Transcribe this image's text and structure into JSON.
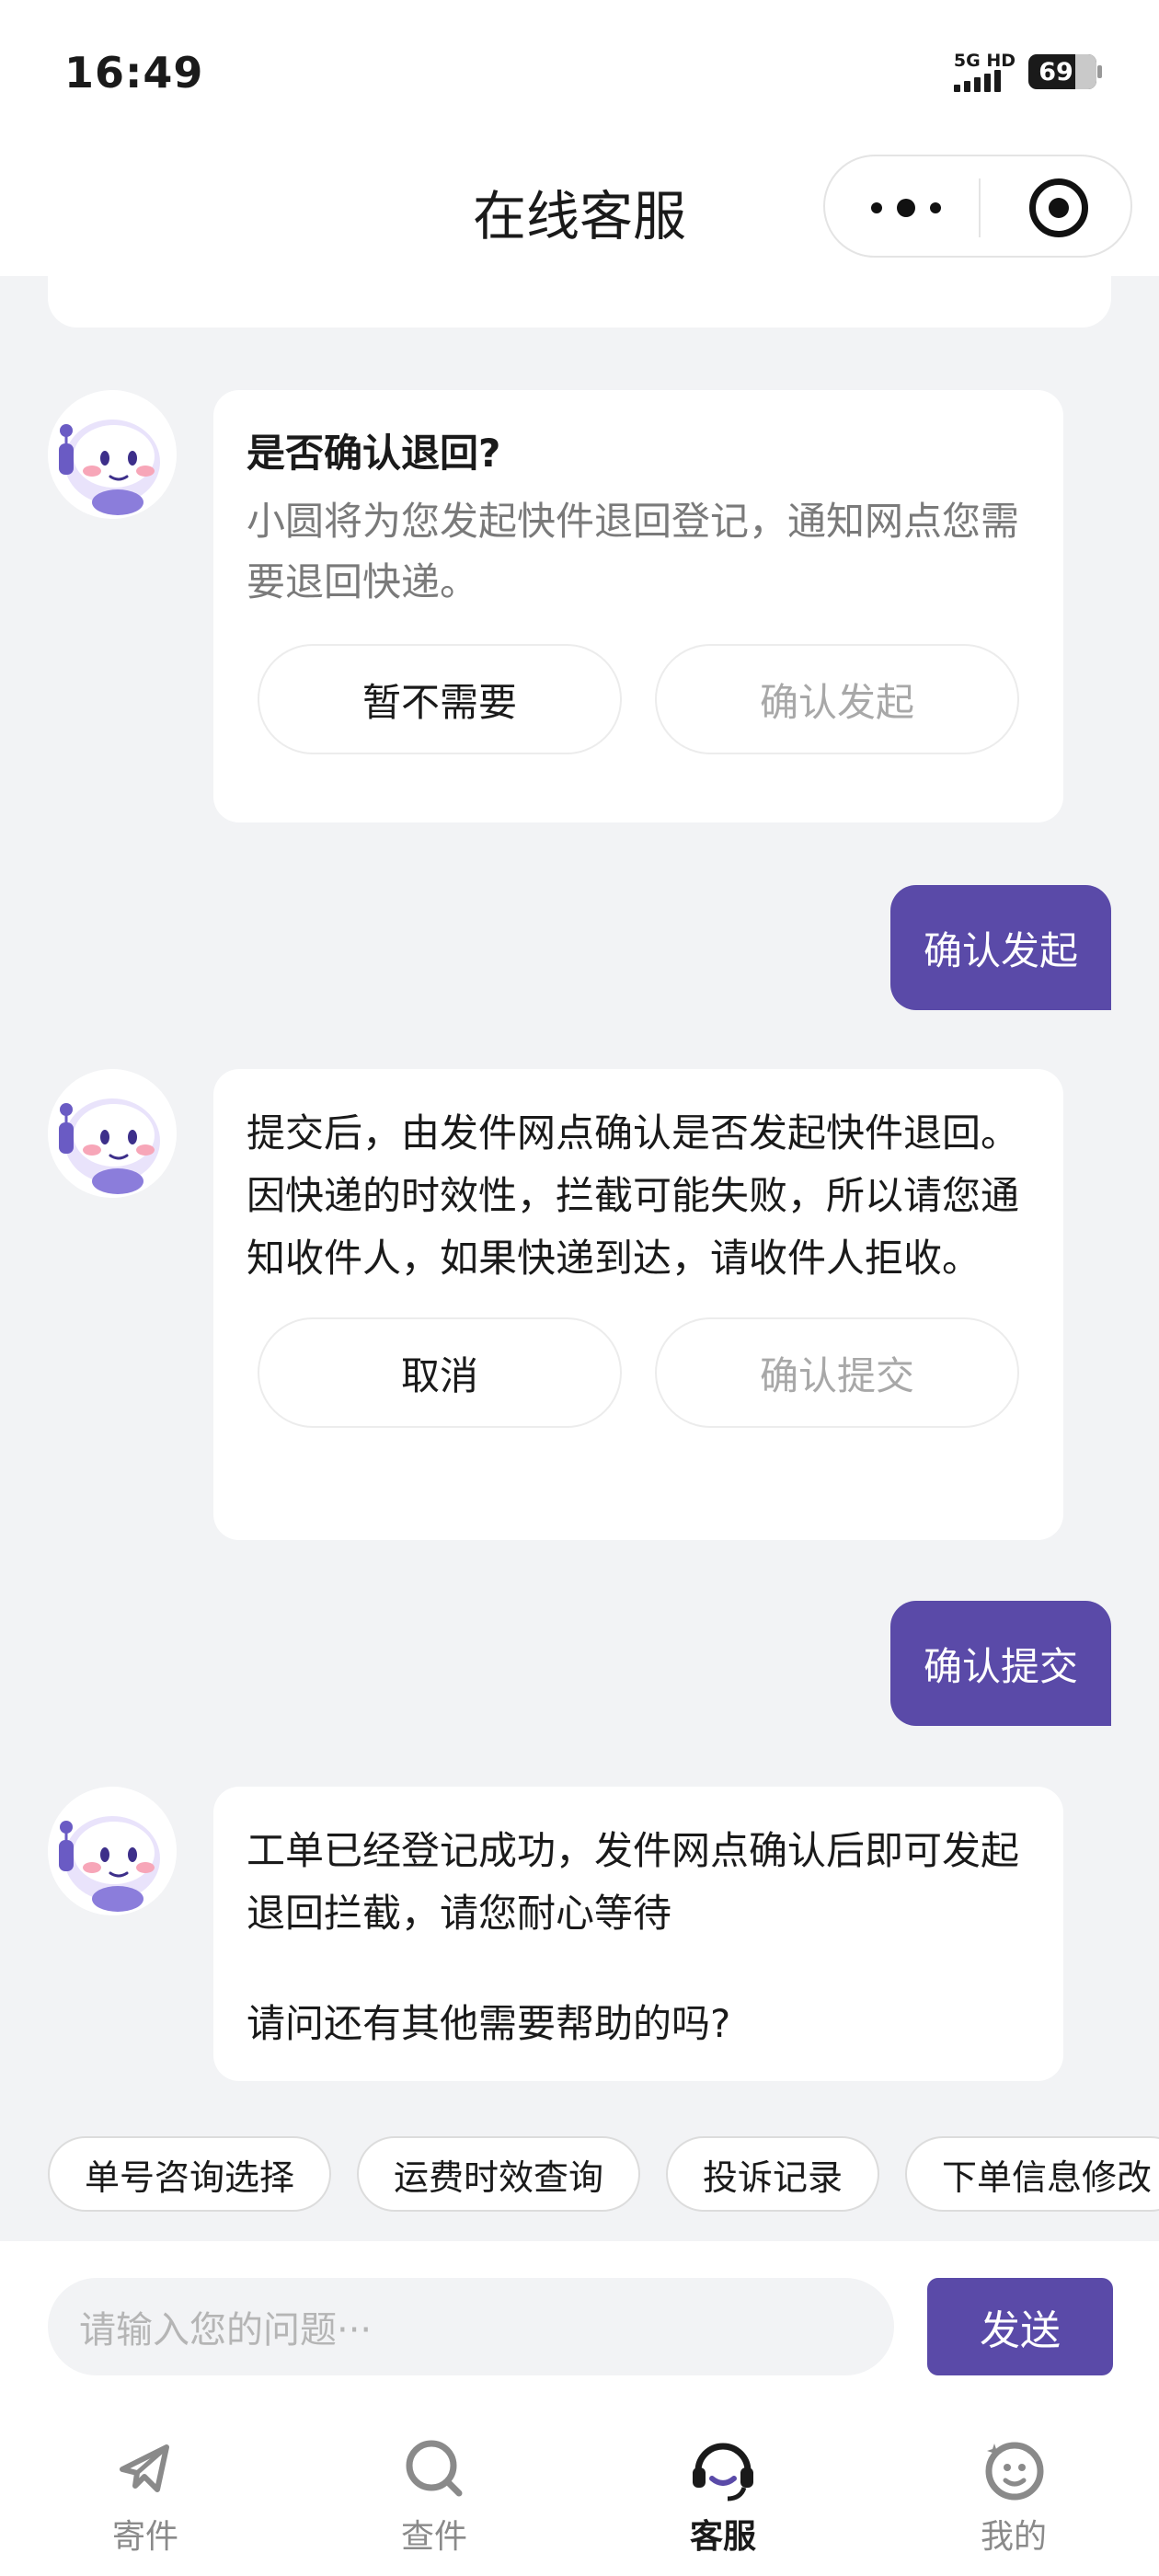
{
  "status_bar": {
    "time": "16:49",
    "network": "5G HD",
    "battery": "69"
  },
  "header": {
    "title": "在线客服"
  },
  "messages": [
    {
      "from": "bot",
      "title": "是否确认退回?",
      "text": "小圆将为您发起快件退回登记，通知网点您需要退回快递。",
      "buttons": [
        "暂不需要",
        "确认发起"
      ]
    },
    {
      "from": "user",
      "text": "确认发起"
    },
    {
      "from": "bot",
      "text": "提交后，由发件网点确认是否发起快件退回。因快递的时效性，拦截可能失败，所以请您通知收件人，如果快递到达，请收件人拒收。",
      "buttons": [
        "取消",
        "确认提交"
      ]
    },
    {
      "from": "user",
      "text": "确认提交"
    },
    {
      "from": "bot",
      "text": "工单已经登记成功，发件网点确认后即可发起退回拦截，请您耐心等待",
      "text2": "请问还有其他需要帮助的吗?"
    }
  ],
  "quick_replies": [
    "单号咨询选择",
    "运费时效查询",
    "投诉记录",
    "下单信息修改"
  ],
  "input": {
    "placeholder": "请输入您的问题···",
    "send_label": "发送"
  },
  "tabs": [
    {
      "label": "寄件",
      "icon": "send-plane-icon",
      "active": false
    },
    {
      "label": "查件",
      "icon": "search-icon",
      "active": false
    },
    {
      "label": "客服",
      "icon": "headset-icon",
      "active": true
    },
    {
      "label": "我的",
      "icon": "smile-face-icon",
      "active": false
    }
  ],
  "colors": {
    "accent": "#5a4aa8",
    "background": "#f2f3f5"
  }
}
